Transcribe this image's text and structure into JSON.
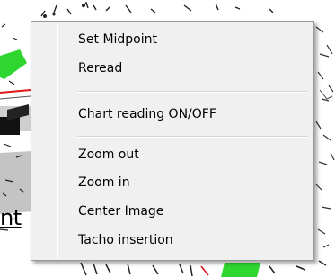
{
  "background": {
    "partial_text": "nt"
  },
  "menu": {
    "items": [
      {
        "label": "Set Midpoint"
      },
      {
        "label": "Reread"
      },
      {
        "label": "Chart reading ON/OFF"
      },
      {
        "label": "Zoom out"
      },
      {
        "label": "Zoom in"
      },
      {
        "label": "Center Image"
      },
      {
        "label": "Tacho insertion"
      }
    ]
  },
  "colors": {
    "menu_bg": "#f0f0f0",
    "menu_border": "#979797",
    "chart_green": "#2fd62f",
    "chart_red": "#e01818",
    "chart_gray": "#c4c4c4"
  }
}
